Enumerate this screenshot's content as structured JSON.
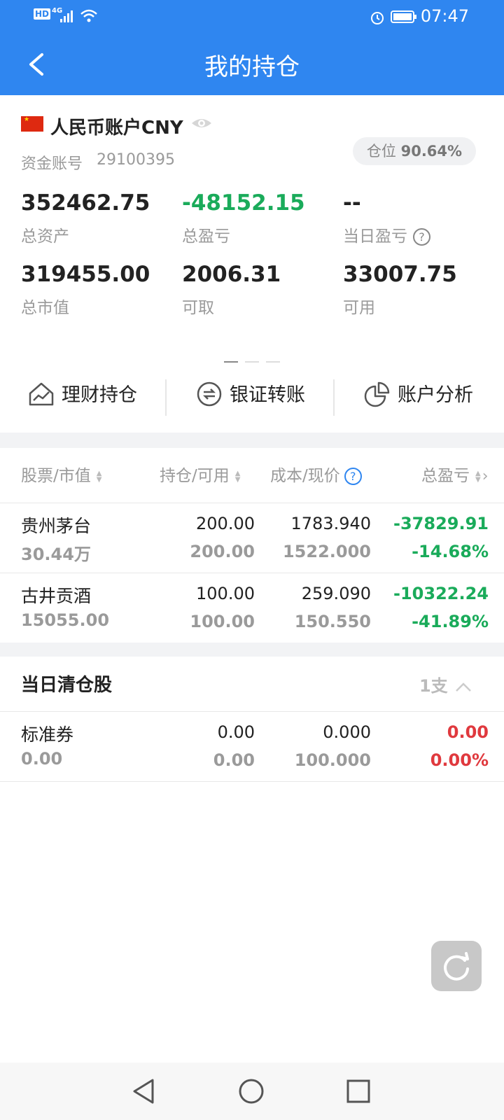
{
  "status_bar": {
    "hd": "HD",
    "network": "4G",
    "time": "07:47"
  },
  "header": {
    "title": "我的持仓"
  },
  "account": {
    "name": "人民币账户CNY",
    "number_label": "资金账号",
    "number": "29100395",
    "position_label": "仓位",
    "position_value": "90.64%",
    "stats": [
      {
        "value": "352462.75",
        "label": "总资产"
      },
      {
        "value": "-48152.15",
        "label": "总盈亏"
      },
      {
        "value": "--",
        "label": "当日盈亏"
      },
      {
        "value": "319455.00",
        "label": "总市值"
      },
      {
        "value": "2006.31",
        "label": "可取"
      },
      {
        "value": "33007.75",
        "label": "可用"
      }
    ]
  },
  "actions": [
    {
      "label": "理财持仓",
      "icon": "chart-house-icon"
    },
    {
      "label": "银证转账",
      "icon": "transfer-icon"
    },
    {
      "label": "账户分析",
      "icon": "pie-chart-icon"
    }
  ],
  "table": {
    "headers": [
      "股票/市值",
      "持仓/可用",
      "成本/现价",
      "总盈亏"
    ],
    "rows": [
      {
        "name": "贵州茅台",
        "market_value": "30.44万",
        "holding": "200.00",
        "available": "200.00",
        "cost": "1783.940",
        "price": "1522.000",
        "pl": "-37829.91",
        "pl_pct": "-14.68%"
      },
      {
        "name": "古井贡酒",
        "market_value": "15055.00",
        "holding": "100.00",
        "available": "100.00",
        "cost": "259.090",
        "price": "150.550",
        "pl": "-10322.24",
        "pl_pct": "-41.89%"
      }
    ]
  },
  "cleared": {
    "title": "当日清仓股",
    "count": "1支",
    "rows": [
      {
        "name": "标准券",
        "market_value": "0.00",
        "holding": "0.00",
        "available": "0.00",
        "cost": "0.000",
        "price": "100.000",
        "pl": "0.00",
        "pl_pct": "0.00%"
      }
    ]
  },
  "colors": {
    "brand": "#2f86f0",
    "loss": "#1aab5a",
    "gain": "#e0393e"
  }
}
